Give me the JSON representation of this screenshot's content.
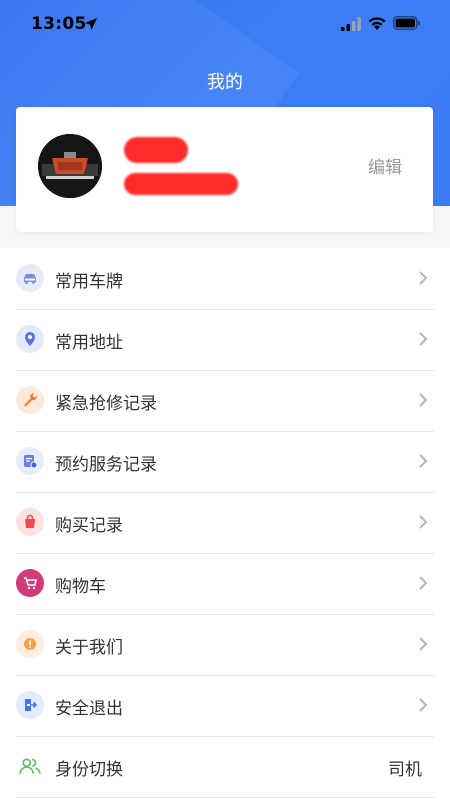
{
  "status_bar": {
    "time": "13:05"
  },
  "header": {
    "title": "我的"
  },
  "profile": {
    "edit_label": "编辑"
  },
  "menu": {
    "items": [
      {
        "label": "常用车牌",
        "icon": "car-icon",
        "color": "#7a8fd8"
      },
      {
        "label": "常用地址",
        "icon": "location-pin-icon",
        "color": "#5b74e0"
      },
      {
        "label": "紧急抢修记录",
        "icon": "wrench-icon",
        "color": "#f07a2e"
      },
      {
        "label": "预约服务记录",
        "icon": "calendar-clock-icon",
        "color": "#6a7ee8"
      },
      {
        "label": "购买记录",
        "icon": "shopping-bag-icon",
        "color": "#f04a4a"
      },
      {
        "label": "购物车",
        "icon": "shopping-cart-icon",
        "color": "#d23a7a"
      },
      {
        "label": "关于我们",
        "icon": "info-icon",
        "color": "#f5a04a"
      },
      {
        "label": "安全退出",
        "icon": "logout-icon",
        "color": "#3d78f0"
      }
    ],
    "identity": {
      "label": "身份切换",
      "value": "司机",
      "icon": "users-icon",
      "color": "#5cc36a"
    }
  }
}
